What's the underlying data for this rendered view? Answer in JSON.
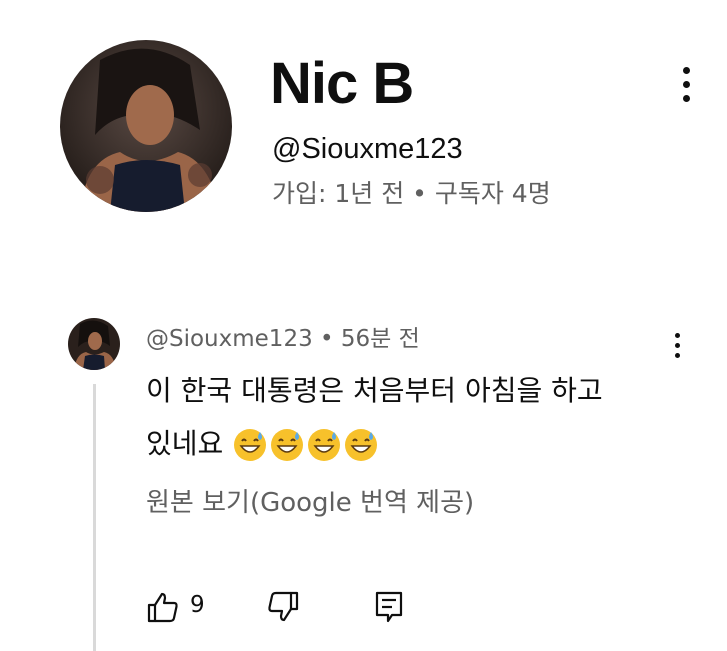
{
  "profile": {
    "name": "Nic B",
    "handle": "@Siouxme123",
    "meta": "가입: 1년 전 • 구독자 4명"
  },
  "comment": {
    "header": "@Siouxme123 • 56분 전",
    "text_line1": "이 한국 대통령은 처음부터 아침을 하고",
    "text_line2": "있네요",
    "emojis": [
      "grinning-sweat-emoji",
      "grinning-sweat-emoji",
      "grinning-sweat-emoji",
      "grinning-sweat-emoji"
    ],
    "translate_link": "원본 보기(Google 번역 제공)",
    "like_count": "9"
  },
  "colors": {
    "text_primary": "#0f0f0f",
    "text_secondary": "#606060",
    "thread_line": "#d9d9d9",
    "emoji_face": "#f7c12b",
    "emoji_sweat": "#5aa9e6"
  },
  "icons": [
    "more-vert-icon",
    "thumbs-up-icon",
    "thumbs-down-icon",
    "reply-icon"
  ]
}
